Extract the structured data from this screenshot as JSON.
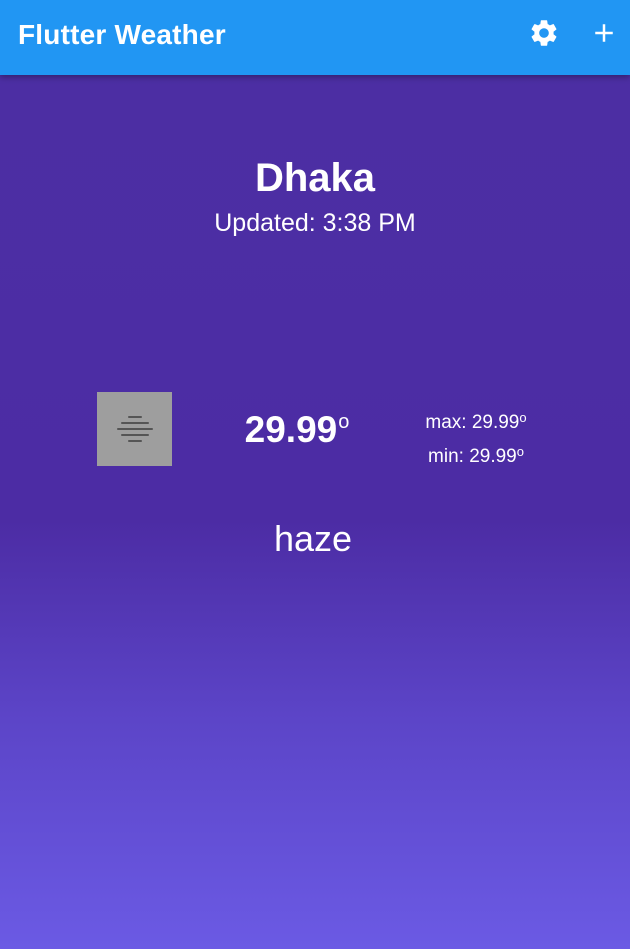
{
  "appbar": {
    "title": "Flutter Weather",
    "actions": [
      {
        "icon": "settings-icon"
      },
      {
        "icon": "add-icon"
      }
    ],
    "color": "#2196f3"
  },
  "weather": {
    "city": "Dhaka",
    "updated": "Updated: 3:38 PM",
    "icon": "haze-icon",
    "temperature": "29.99",
    "degree_symbol": "o",
    "max_label": "max: 29.99",
    "min_label": "min: 29.99",
    "condition": "haze"
  },
  "colors": {
    "background_top": "#4c2fa3",
    "background_bottom": "#6b5ae4",
    "icon_tile": "#9e9e9e",
    "text": "#ffffff"
  }
}
